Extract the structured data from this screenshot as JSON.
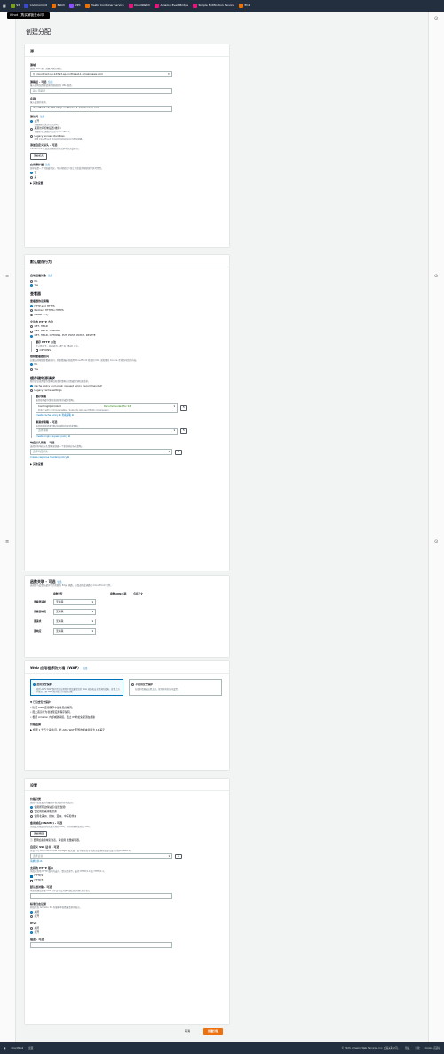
{
  "topbar": {
    "services": [
      {
        "name": "S3",
        "color": "#7aa116"
      },
      {
        "name": "CodeCommit",
        "color": "#3b48cc"
      },
      {
        "name": "Batch",
        "color": "#ed7100"
      },
      {
        "name": "VPC",
        "color": "#8c4fff"
      },
      {
        "name": "Elastic Container Service",
        "color": "#ed7100"
      },
      {
        "name": "CloudWatch",
        "color": "#e7157b"
      },
      {
        "name": "Amazon EventBridge",
        "color": "#e7157b"
      },
      {
        "name": "Simple Notification Service",
        "color": "#e7157b"
      },
      {
        "name": "EC2",
        "color": "#ed7100"
      }
    ]
  },
  "overlay": {
    "ishot": "iShot（购买解锁去水印）"
  },
  "page": {
    "title": "创建分配"
  },
  "origin": {
    "header": "源",
    "domain_label": "源域",
    "domain_desc": "选择 AWS 源，或输入源的域名。",
    "domain_value": "cloudfront-s3-123.s3.ap-northeast-1.amazonaws.com",
    "path_label": "源路径 - 可选",
    "path_info": "信息",
    "path_desc": "输入要附加到源请求的源域名的 URL 路径。",
    "path_placeholder": "输入源路径",
    "name_label": "名称",
    "name_desc": "输入此源的名称。",
    "name_value": "cloudfront-s3-123.s3.ap-northeast-1.amazonaws.com",
    "access_label": "源访问",
    "access_info": "信息",
    "access_options": [
      {
        "label": "公开",
        "desc": "存储桶必须允许公开访问。",
        "selected": true
      },
      {
        "label": "来源访问控制设置(推荐)",
        "desc": "存储桶可以限制为仅访问 CloudFront。",
        "selected": false
      },
      {
        "label": "Legacy access identities",
        "desc": "使用 CloudFront 源访问身份(OAI)访问 S3 存储桶。",
        "selected": false
      }
    ],
    "custom_header_label": "添加自定义标头 - 可选",
    "custom_header_desc": "CloudFront 在发送到源的所有请求中包含此标头。",
    "add_header_button": "添加标头",
    "shield_label": "启用源护盾",
    "shield_info": "信息",
    "shield_desc": "源护盾是一个附加缓存层，可以帮助减少源上的负载并帮助保护其可用性。",
    "shield_options": [
      {
        "label": "否",
        "selected": true
      },
      {
        "label": "是",
        "selected": false
      }
    ],
    "advanced": "其他设置"
  },
  "behavior": {
    "header": "默认缓存行为",
    "compress_label": "自动压缩对象",
    "compress_info": "信息",
    "compress_options": [
      {
        "label": "No",
        "selected": false
      },
      {
        "label": "Yes",
        "selected": true
      }
    ],
    "viewer_title": "查看器",
    "protocol_label": "查看器协议策略",
    "protocol_options": [
      {
        "label": "HTTP and HTTPS",
        "selected": true
      },
      {
        "label": "Redirect HTTP to HTTPS",
        "selected": false
      },
      {
        "label": "HTTPS only",
        "selected": false
      }
    ],
    "methods_label": "允许的 HTTP 方法",
    "methods_options": [
      {
        "label": "GET, HEAD",
        "selected": false
      },
      {
        "label": "GET, HEAD, OPTIONS",
        "selected": false
      },
      {
        "label": "GET, HEAD, OPTIONS, PUT, POST, PATCH, DELETE",
        "selected": true
      }
    ],
    "cache_methods_label": "缓存 HTTP 方法",
    "cache_methods_desc": "默认情况下，始终缓存 GET 和 HEAD 方法。",
    "cache_methods_option": "OPTIONS",
    "restrict_label": "限制查看器访问",
    "restrict_desc": "如果选择限制查看器访问，则查看器必须使用 CloudFront 签署的 URL 或签署的 Cookie 才能访问您的内容。",
    "restrict_options": [
      {
        "label": "No",
        "selected": true
      },
      {
        "label": "Yes",
        "selected": false
      }
    ],
    "cache_title": "缓存键和源请求",
    "cache_desc": "我们建议使用缓存策略和源请求策略来控制缓存键和源请求。",
    "cache_options": [
      {
        "label": "Cache policy and origin request policy (recommended)",
        "selected": true
      },
      {
        "label": "Legacy cache settings",
        "selected": false
      }
    ],
    "cache_policy_label": "缓存策略",
    "cache_policy_desc": "选择现有缓存策略或创建新的缓存策略。",
    "cache_policy_value": "CachingOptimized",
    "cache_policy_badge": "Recommended for S3",
    "cache_policy_note": "Policy with caching enabled. Supports Gzip and Brotli compression.",
    "create_cache_link": "Create cache policy",
    "view_policy_link": "查看策略",
    "origin_req_label": "源请求策略 - 可选",
    "origin_req_desc": "选择现有源请求策略或创建新的源请求策略。",
    "origin_req_placeholder": "选择策略",
    "create_origin_link": "Create origin request policy",
    "resp_label": "响应标头策略 - 可选",
    "resp_desc": "选择现有响应标头策略或创建一个新的响应标头策略。",
    "resp_placeholder": "选择响应标头",
    "create_resp_link": "Create response headers policy",
    "advanced": "其他设置"
  },
  "functions": {
    "header": "函数关联 - 可选",
    "info": "信息",
    "desc": "选择要与此默认缓存行为关联的 Edge 函数，以及调用此函数的 CloudFront 事件。",
    "columns": [
      "函数类型",
      "函数 ARN/名称",
      "包括正文"
    ],
    "rows": [
      {
        "event": "查看器请求",
        "type": "无关联"
      },
      {
        "event": "查看器响应",
        "type": "无关联"
      },
      {
        "event": "源请求",
        "type": "无关联"
      },
      {
        "event": "源响应",
        "type": "无关联"
      }
    ]
  },
  "waf": {
    "header": "Web 应用程序防火墙（WAF）",
    "info": "信息",
    "enable_label": "启用安全保护",
    "enable_desc": "使用 AWS WAF 保护您的应用程序免受最常见的 Web 威胁和安全漏洞的侵害。查看上方列表以了解 Web 服务器上的保护措施。",
    "disable_label": "不启用安全保护",
    "disable_desc": "在保护措施被启用之前，保持原有的访问设置。",
    "expand_label": "已包含安全保护",
    "bullets": [
      "防范 Web 应用程序中最常见的漏洞。",
      "阻止恶意行为者发现应用程序漏洞。",
      "根据 Amazon 内部威胁情报，阻止 IP 地址免受潜在威胁"
    ],
    "pricing_label": "价格估算",
    "pricing_text": "▶ 根据 1 千万个请求/月，此 AWS WAF 配置的成本估算为 14 美元"
  },
  "settings": {
    "header": "设置",
    "price_label": "价格分类",
    "price_desc": "选择与您要支付的最高价格关联的价格类别。",
    "price_options": [
      {
        "label": "使用所有边缘站点(最佳性能)",
        "selected": true
      },
      {
        "label": "仅使用北美洲和欧洲",
        "selected": false
      },
      {
        "label": "使用北美洲、欧洲、亚洲、中东和非洲",
        "selected": false
      }
    ],
    "cname_label": "备用域名(CNAME) - 可选",
    "cname_desc": "添加此分配使用的自定义域名 URL，并将对象附加到该 URL。",
    "add_item_button": "添加项目",
    "cname_note": "要添加备用域名列表，请使用 批量编辑器。",
    "cert_label": "自定义 SSL 证书 - 可选",
    "cert_desc": "将证书与 AWS Certificate Manager 相关联，证书必须位于美国东部(弗吉尼亚北部)区域(us-east-1)。",
    "cert_placeholder": "选择证书",
    "cert_link": "请求证书",
    "http_label": "支持的 HTTP 版本",
    "http_desc": "添加对其他 HTTP 版本的支持，默认情况下，支持 HTTP/1.0 和 HTTP/1.1。",
    "http_options": [
      {
        "label": "HTTP/2",
        "checked": true
      },
      {
        "label": "HTTP/3",
        "checked": false
      }
    ],
    "root_label": "默认根对象 - 可选",
    "root_desc": "当查看器请求根 URL 而不是特定对象时返回的对象(文件名)。",
    "log_label": "标准日志记录",
    "log_desc": "获取包含 Amazon S3 存储桶中查看器请求的日志。",
    "log_options": [
      {
        "label": "关闭",
        "selected": true
      },
      {
        "label": "打开",
        "selected": false
      }
    ],
    "ipv6_label": "IPv6",
    "ipv6_options": [
      {
        "label": "关闭",
        "selected": false
      },
      {
        "label": "打开",
        "selected": true
      }
    ],
    "desc_label": "描述 - 可选"
  },
  "actions": {
    "cancel": "取消",
    "create": "创建分配"
  },
  "footer": {
    "cloudshell": "CloudShell",
    "feedback": "反馈",
    "copyright": "© 2023, Amazon Web Services, Inc. 或其关联公司。",
    "privacy": "隐私",
    "terms": "条款",
    "cookie": "Cookie 首选项"
  }
}
